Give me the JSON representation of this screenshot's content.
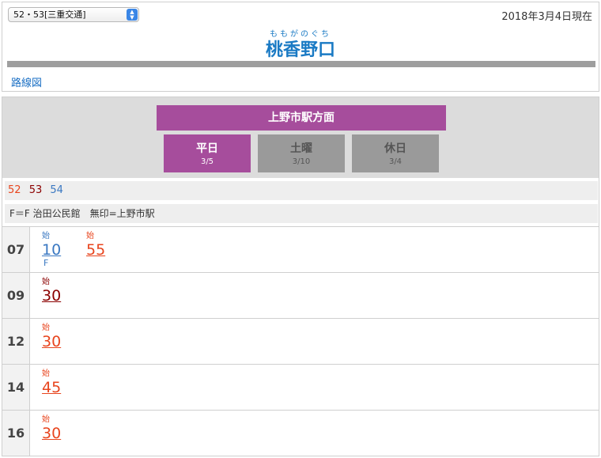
{
  "header": {
    "route_select_value": "52・53[三重交通]",
    "date_label": "2018年3月4日現在",
    "station_ruby": "ももがのぐち",
    "station_name": "桃香野口",
    "route_map_link": "路線図"
  },
  "timetable": {
    "direction": "上野市駅方面",
    "tabs": [
      {
        "label": "平日",
        "date": "3/5",
        "active": true
      },
      {
        "label": "土曜",
        "date": "3/10",
        "active": false
      },
      {
        "label": "休日",
        "date": "3/4",
        "active": false
      }
    ],
    "routes": [
      {
        "label": "52",
        "color": "#e8451e"
      },
      {
        "label": "53",
        "color": "#8b0000"
      },
      {
        "label": "54",
        "color": "#3a78c2"
      }
    ],
    "notes": "F＝F 治田公民館　無印=上野市駅",
    "rows": [
      {
        "hour": "07",
        "trips": [
          {
            "origin": "始",
            "minute": "10",
            "dest": "F",
            "color": "#3a78c2"
          },
          {
            "origin": "始",
            "minute": "55",
            "dest": "",
            "color": "#e8451e"
          }
        ]
      },
      {
        "hour": "09",
        "trips": [
          {
            "origin": "始",
            "minute": "30",
            "dest": "",
            "color": "#8b0000"
          }
        ]
      },
      {
        "hour": "12",
        "trips": [
          {
            "origin": "始",
            "minute": "30",
            "dest": "",
            "color": "#e8451e"
          }
        ]
      },
      {
        "hour": "14",
        "trips": [
          {
            "origin": "始",
            "minute": "45",
            "dest": "",
            "color": "#e8451e"
          }
        ]
      },
      {
        "hour": "16",
        "trips": [
          {
            "origin": "始",
            "minute": "30",
            "dest": "",
            "color": "#e8451e"
          }
        ]
      }
    ]
  }
}
